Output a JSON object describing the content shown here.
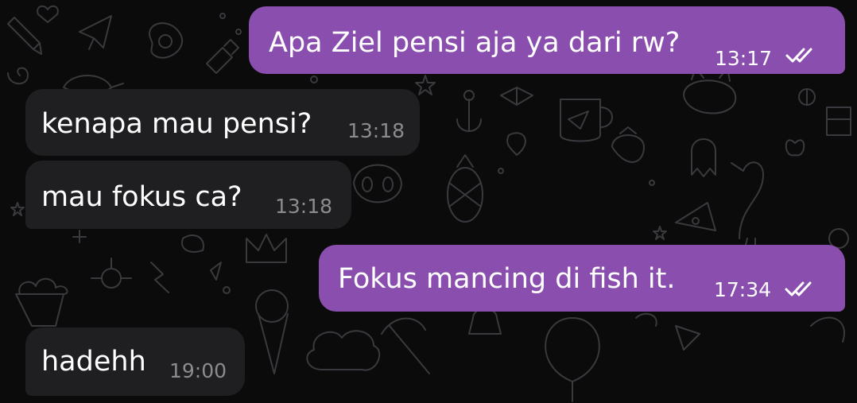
{
  "conversation": {
    "messages": [
      {
        "direction": "outgoing",
        "text": "Apa Ziel pensi aja ya dari rw?",
        "time": "13:17",
        "status_icon": "double-check-icon"
      },
      {
        "direction": "incoming",
        "text": "kenapa mau pensi?",
        "time": "13:18"
      },
      {
        "direction": "incoming",
        "text": "mau fokus ca?",
        "time": "13:18"
      },
      {
        "direction": "outgoing",
        "text": "Fokus mancing di fish it.",
        "time": "17:34",
        "status_icon": "double-check-icon"
      },
      {
        "direction": "incoming",
        "text": "hadehh",
        "time": "19:00"
      }
    ]
  },
  "colors": {
    "background": "#0b0b0c",
    "outgoing_bubble": "#8a4fae",
    "incoming_bubble": "#1f1f21",
    "incoming_time": "#8c8c90",
    "doodle_stroke": "#3a3a3e"
  }
}
